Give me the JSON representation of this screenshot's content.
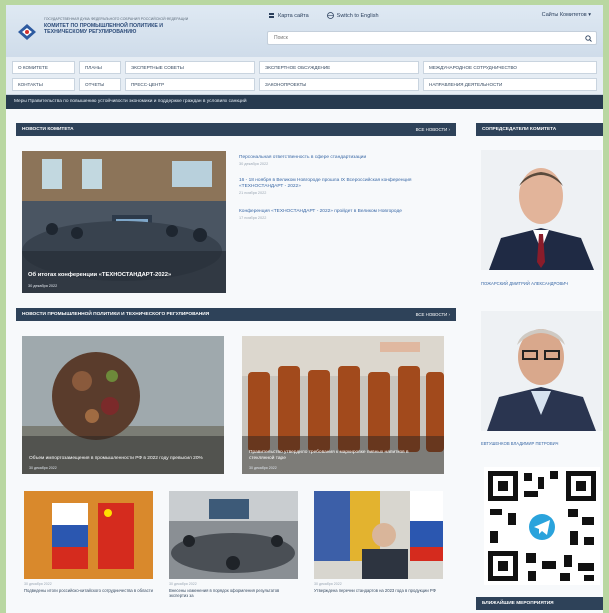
{
  "header": {
    "logo_small": "Государственная Дума Федерального Собрания Российской Федерации",
    "logo_title": "Комитет по промышленной политике и техническому регулированию",
    "links": [
      "Карта сайта",
      "Switch to English"
    ],
    "lang_switch": "Сайты Комитетов ▾",
    "search_placeholder": "Поиск"
  },
  "menu": {
    "row1": [
      "О Комитете",
      "Планы",
      "Экспертные советы",
      "Экспертное обсуждение",
      "Международное сотрудничество"
    ],
    "row2": [
      "Контакты",
      "Отчеты",
      "Пресс-центр",
      "Законопроекты",
      "Направления деятельности"
    ]
  },
  "ticker": "Меры Правительства по повышению устойчивости экономики и поддержке граждан в условиях санкций",
  "committee_news": {
    "title": "Новости Комитета",
    "all_label": "Все новости ›",
    "main": {
      "caption": "Об итогах конференции «ТЕХНОСТАНДАРТ-2022»",
      "date": "30 декабря 2022"
    },
    "side": [
      {
        "title": "Персональная ответственность в сфере стандартизации",
        "date": "30 декабря 2022"
      },
      {
        "title": "16 - 18 ноября в Великом Новгороде прошла IX Всероссийская конференция «ТЕХНОСТАНДАРТ - 2022»",
        "date": "21 ноября 2022"
      },
      {
        "title": "Конференция «ТЕХНОСТАНДАРТ - 2022» пройдет в Великом Новгороде",
        "date": "17 ноября 2022"
      }
    ]
  },
  "industry_news": {
    "title": "Новости промышленной политики и технического регулирования",
    "all_label": "Все новости ›",
    "big": [
      {
        "caption": "Объем импортозамещения в промышленности РФ в 2022 году превысил 20%",
        "date": "30 декабря 2022"
      },
      {
        "caption": "Правительство утвердило требования к маркировке пивных напитков в стеклянной таре",
        "date": "30 декабря 2022"
      }
    ],
    "small": [
      {
        "date": "30 декабря 2022",
        "title": "Подведены итоги российско-китайского сотрудничества в области"
      },
      {
        "date": "30 декабря 2022",
        "title": "Внесены изменения в порядок оформления результатов экспертиз за"
      },
      {
        "date": "30 декабря 2022",
        "title": "Утверждена перечни стандартов на 2023 года в продукции РФ"
      }
    ]
  },
  "chairman": {
    "title": "Сопредседатели Комитета",
    "persons": [
      {
        "name": "Пожарский Дмитрий Александрович"
      },
      {
        "name": "Евтушенков Владимир Петрович"
      }
    ]
  },
  "footer_section": {
    "title": "Ближайшие мероприятия"
  },
  "colors": {
    "background": "#b9d7a1",
    "header_bar": "#2e4259",
    "link": "#3867a5"
  }
}
